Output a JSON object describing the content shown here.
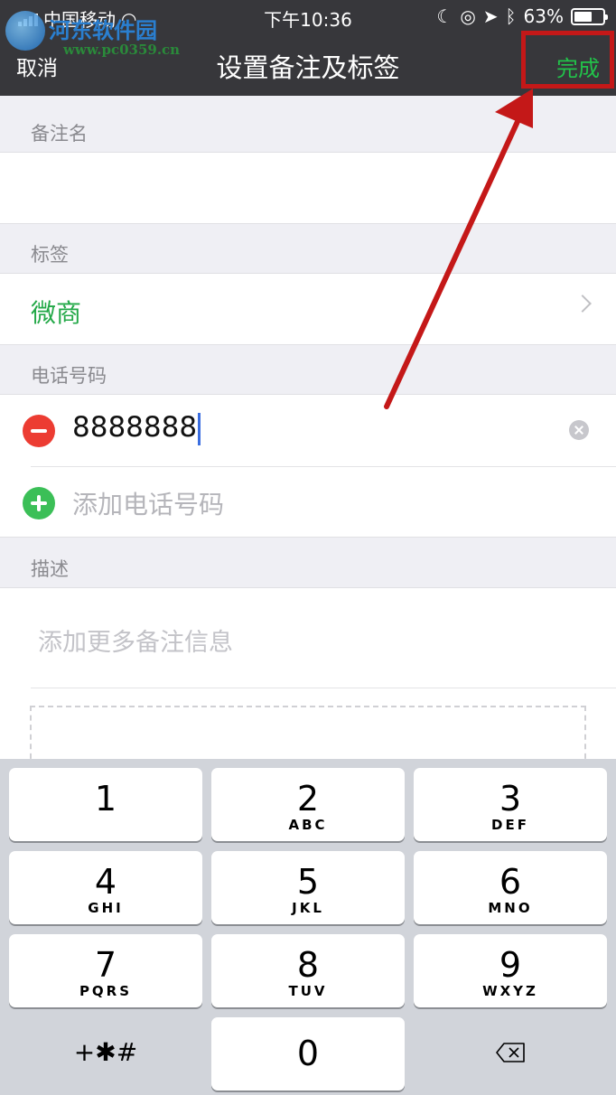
{
  "status_bar": {
    "carrier": "中国移动",
    "time": "下午10:36",
    "battery": "63%",
    "battery_level": 0.63
  },
  "watermark": {
    "name": "河东软件园",
    "url": "www.pc0359.cn"
  },
  "nav": {
    "cancel_label": "取消",
    "title": "设置备注及标签",
    "done_label": "完成"
  },
  "sections": {
    "remark_header": "备注名",
    "remark_value": "",
    "tag_header": "标签",
    "tag_value": "微商",
    "phone_header": "电话号码",
    "phone_value": "8888888",
    "add_phone_placeholder": "添加电话号码",
    "desc_header": "描述",
    "desc_placeholder": "添加更多备注信息"
  },
  "keypad": {
    "keys": [
      {
        "digit": "1",
        "letters": ""
      },
      {
        "digit": "2",
        "letters": "ABC"
      },
      {
        "digit": "3",
        "letters": "DEF"
      },
      {
        "digit": "4",
        "letters": "GHI"
      },
      {
        "digit": "5",
        "letters": "JKL"
      },
      {
        "digit": "6",
        "letters": "MNO"
      },
      {
        "digit": "7",
        "letters": "PQRS"
      },
      {
        "digit": "8",
        "letters": "TUV"
      },
      {
        "digit": "9",
        "letters": "WXYZ"
      }
    ],
    "symbols": "+✱#",
    "zero": "0"
  },
  "colors": {
    "nav_background": "#37373b",
    "accent_green": "#22c24a",
    "tag_green": "#22a847",
    "delete_red": "#ec3c32",
    "highlight_red": "#c41818"
  }
}
